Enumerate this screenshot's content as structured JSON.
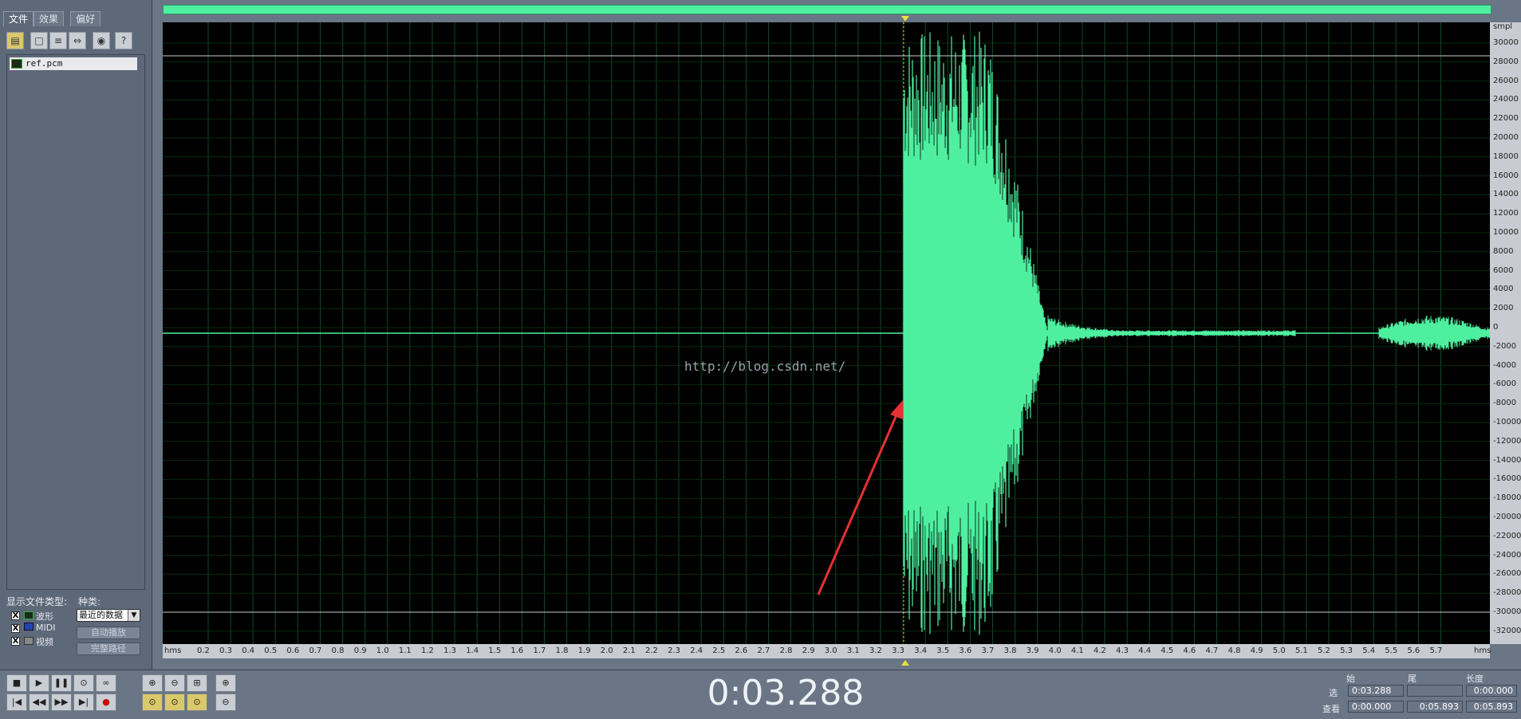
{
  "tabs": [
    {
      "label": "文件",
      "active": true
    },
    {
      "label": "效果",
      "active": false
    },
    {
      "label": "偏好",
      "active": false
    }
  ],
  "toolbar": {
    "icons": [
      "open-folder-icon",
      "open-icon",
      "append-icon",
      "insert-icon",
      "cd-audio-icon",
      "help-icon"
    ],
    "help_glyph": "?"
  },
  "files": [
    {
      "name": "ref.pcm"
    }
  ],
  "file_types": {
    "title": "显示文件类型:",
    "items": [
      {
        "label": "波形",
        "checked": true
      },
      {
        "label": "MIDI",
        "checked": true
      },
      {
        "label": "视频",
        "checked": true
      }
    ],
    "check_mark": "X"
  },
  "sort": {
    "title": "种类:",
    "selected": "最近的数据",
    "auto_play_label": "自动播放",
    "full_path_label": "完整路径"
  },
  "waveform": {
    "watermark": "http://blog.csdn.net/",
    "wave_color": "#4ef0a0",
    "grid_color": "#0f4a20",
    "background": "#000000"
  },
  "time_ruler": {
    "unit_left": "hms",
    "unit_right": "hms",
    "labels": [
      "0.2",
      "0.3",
      "0.4",
      "0.5",
      "0.6",
      "0.7",
      "0.8",
      "0.9",
      "1.0",
      "1.1",
      "1.2",
      "1.3",
      "1.4",
      "1.5",
      "1.6",
      "1.7",
      "1.8",
      "1.9",
      "2.0",
      "2.1",
      "2.2",
      "2.3",
      "2.4",
      "2.5",
      "2.6",
      "2.7",
      "2.8",
      "2.9",
      "3.0",
      "3.1",
      "3.2",
      "3.3",
      "3.4",
      "3.5",
      "3.6",
      "3.7",
      "3.8",
      "3.9",
      "4.0",
      "4.1",
      "4.2",
      "4.3",
      "4.4",
      "4.5",
      "4.6",
      "4.7",
      "4.8",
      "4.9",
      "5.0",
      "5.1",
      "5.2",
      "5.3",
      "5.4",
      "5.5",
      "5.6",
      "5.7"
    ],
    "start_value": 0.2,
    "step": 0.1
  },
  "amp_ruler": {
    "unit": "smpl",
    "labels": [
      "30000",
      "28000",
      "26000",
      "24000",
      "22000",
      "20000",
      "18000",
      "16000",
      "14000",
      "12000",
      "10000",
      "8000",
      "6000",
      "4000",
      "2000",
      "0",
      "-2000",
      "-4000",
      "-6000",
      "-8000",
      "-10000",
      "-12000",
      "-14000",
      "-16000",
      "-18000",
      "-20000",
      "-22000",
      "-24000",
      "-26000",
      "-28000",
      "-30000",
      "-32000"
    ]
  },
  "transport": {
    "buttons_row1": [
      "stop-icon",
      "play-icon",
      "pause-icon",
      "play-to-end-icon",
      "loop-icon"
    ],
    "buttons_row2": [
      "go-start-icon",
      "rewind-icon",
      "fast-forward-icon",
      "go-end-icon",
      "record-icon"
    ],
    "zoom_row1": [
      "zoom-in-icon",
      "zoom-out-icon",
      "zoom-full-icon",
      "zoom-in-vertical-icon"
    ],
    "zoom_row2": [
      "zoom-selection-icon",
      "zoom-left-icon",
      "zoom-right-icon",
      "zoom-out-vertical-icon"
    ]
  },
  "time_display": "0:03.288",
  "selection_info": {
    "header_start": "始",
    "header_end": "尾",
    "header_length": "长度",
    "row_sel_label": "选",
    "row_view_label": "查看",
    "sel_start": "0:03.288",
    "sel_end": "",
    "sel_length": "0:00.000",
    "view_start": "0:00.000",
    "view_end": "0:05.893",
    "view_length": "0:05.893"
  }
}
